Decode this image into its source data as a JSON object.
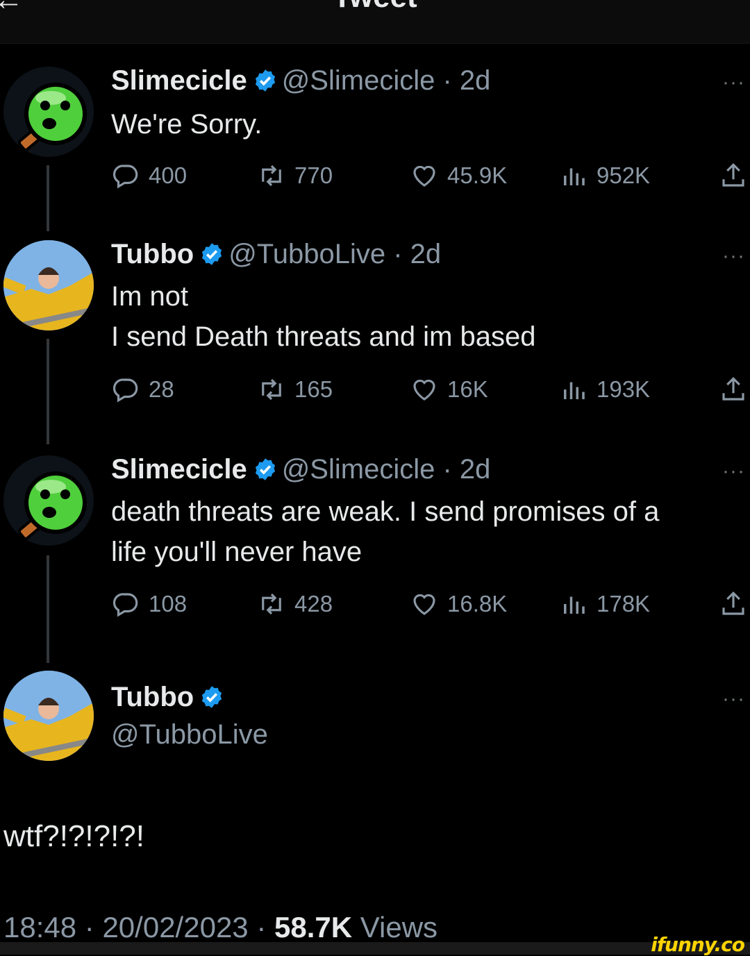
{
  "header": {
    "title": "Tweet",
    "back_icon": "back-arrow-icon"
  },
  "tweets": [
    {
      "name": "Slimecicle",
      "handle": "@Slimecicle",
      "dot": "·",
      "time": "2d",
      "lines": [
        "We're Sorry."
      ],
      "actions": {
        "replies": "400",
        "retweets": "770",
        "likes": "45.9K",
        "views": "952K"
      }
    },
    {
      "name": "Tubbo",
      "handle": "@TubboLive",
      "dot": "·",
      "time": "2d",
      "lines": [
        "Im not",
        "I send Death threats and im based"
      ],
      "actions": {
        "replies": "28",
        "retweets": "165",
        "likes": "16K",
        "views": "193K"
      }
    },
    {
      "name": "Slimecicle",
      "handle": "@Slimecicle",
      "dot": "·",
      "time": "2d",
      "lines": [
        "death threats are weak. I send promises of a",
        "life you'll never have"
      ],
      "actions": {
        "replies": "108",
        "retweets": "428",
        "likes": "16.8K",
        "views": "178K"
      }
    }
  ],
  "main_tweet": {
    "name": "Tubbo",
    "handle": "@TubboLive",
    "text": "wtf?!?!?!?!",
    "time": "18:48",
    "date": "20/02/2023",
    "views_count": "58.7K",
    "views_label": "Views",
    "sep": "·"
  },
  "more_label": "···",
  "watermark": "ifunny.co",
  "colors": {
    "background": "#000000",
    "text": "#e7e9ea",
    "muted": "#8b98a5",
    "verified": "#1d9bf0",
    "watermark": "#ffd400"
  }
}
